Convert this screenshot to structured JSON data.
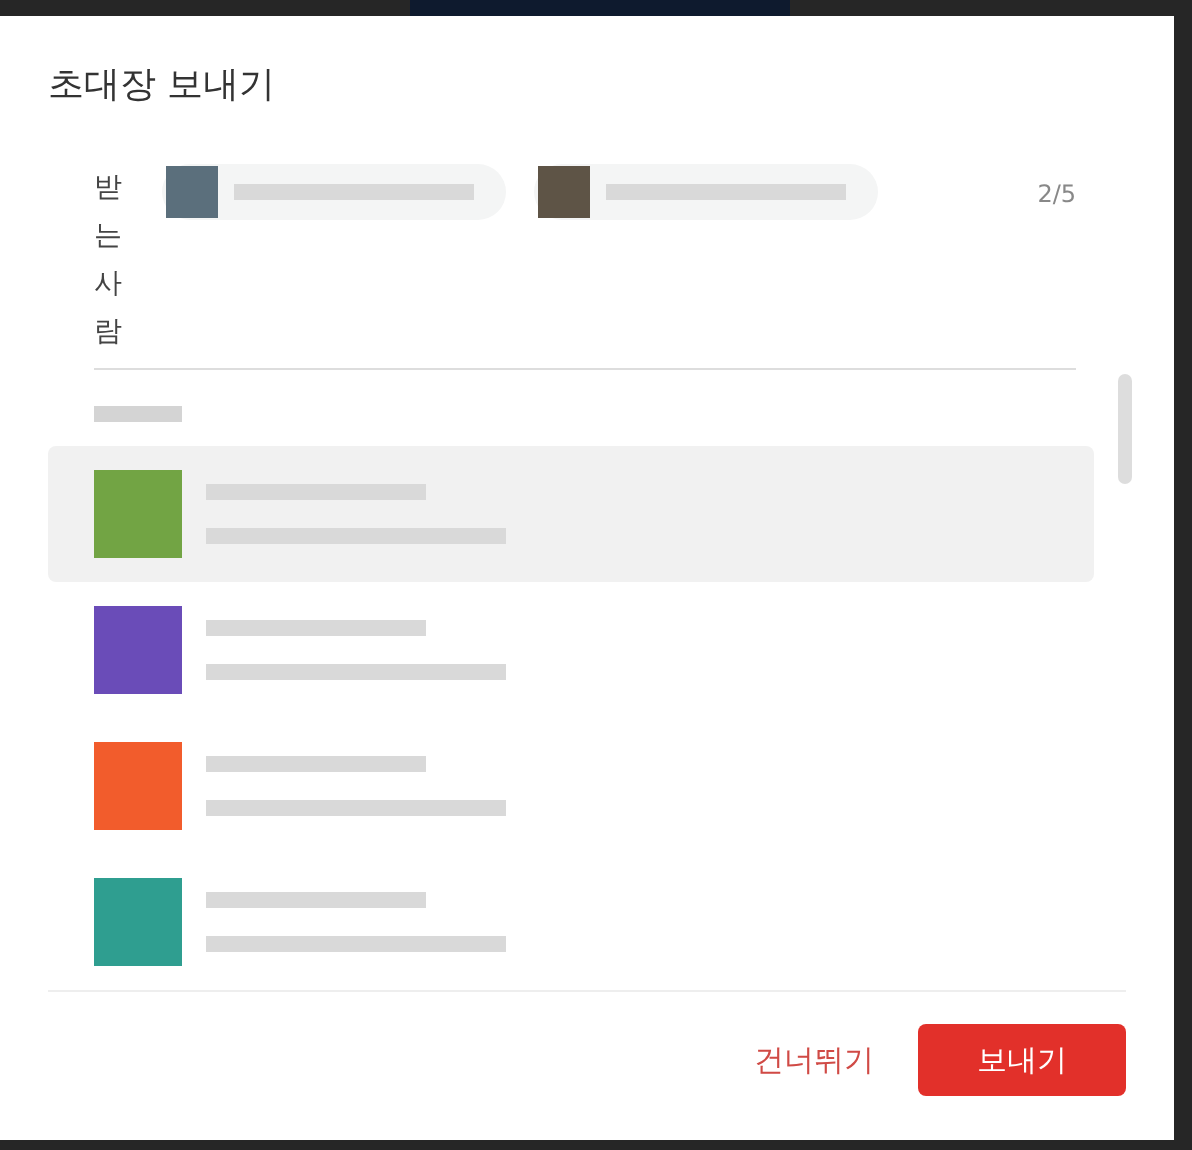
{
  "dialog": {
    "title": "초대장 보내기"
  },
  "recipients": {
    "label": "받는사람",
    "count": "2/5",
    "chips": [
      {
        "color": "#5b6f7c"
      },
      {
        "color": "#5e5446"
      }
    ]
  },
  "contacts": [
    {
      "color": "#72a444",
      "selected": true
    },
    {
      "color": "#6a4cb8",
      "selected": false
    },
    {
      "color": "#f25c2c",
      "selected": false
    },
    {
      "color": "#2f9e90",
      "selected": false
    }
  ],
  "buttons": {
    "skip": "건너뛰기",
    "send": "보내기"
  }
}
